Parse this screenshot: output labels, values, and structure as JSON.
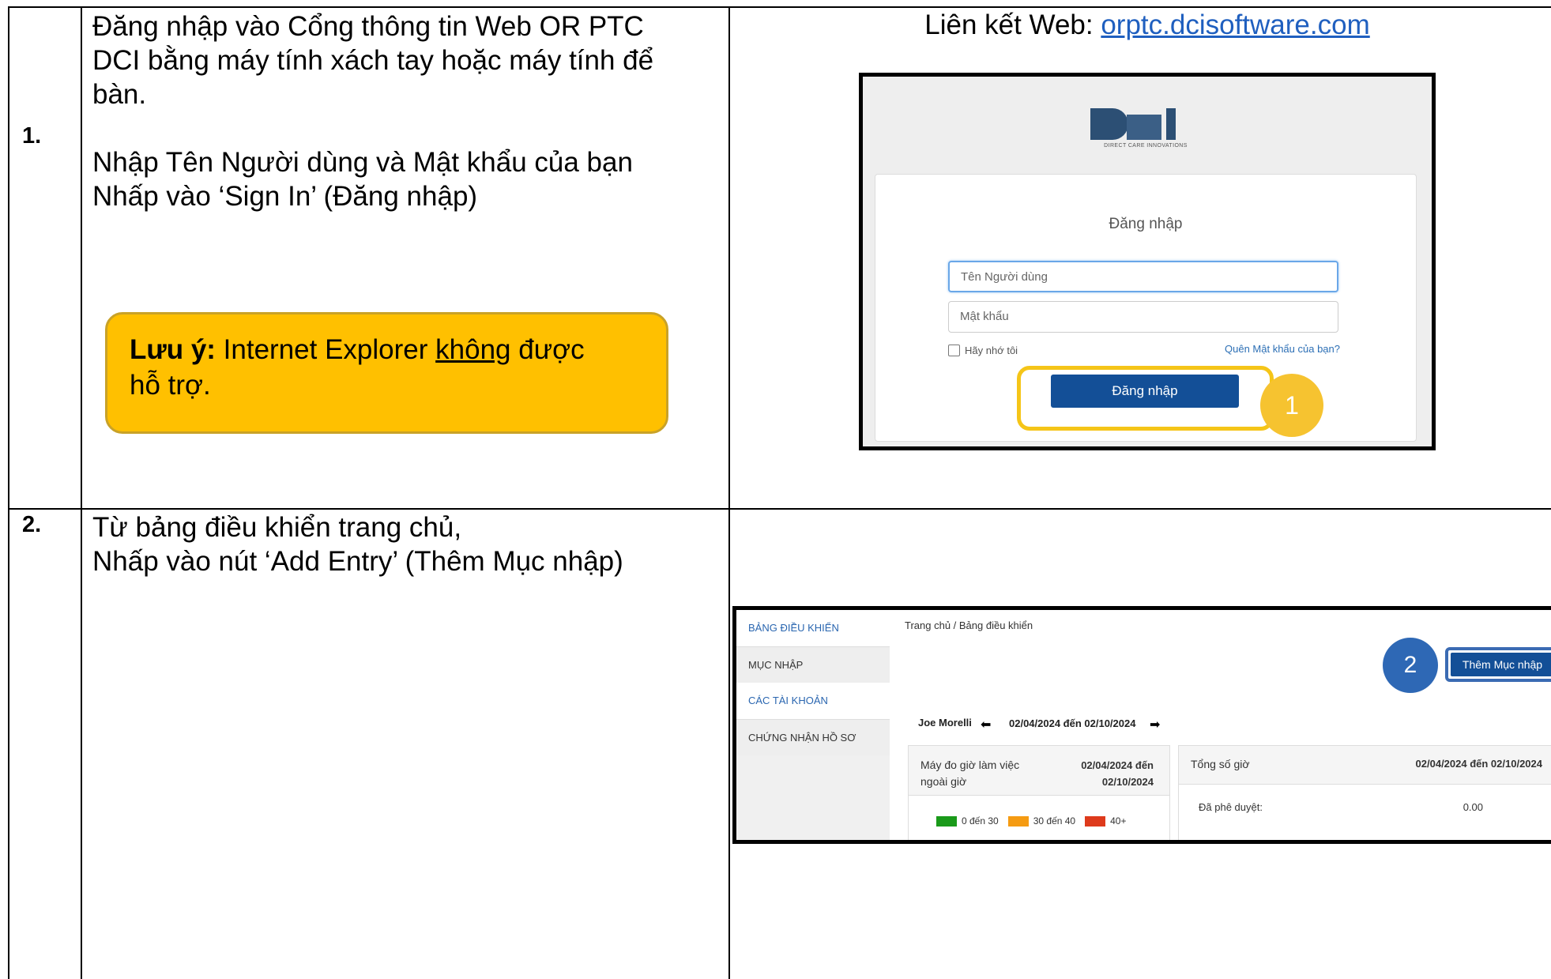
{
  "step1": {
    "number": "1.",
    "instr_lines": [
      "Đăng nhập vào Cổng thông tin Web OR PTC",
      "DCI bằng máy tính xách tay hoặc máy tính để",
      "bàn."
    ],
    "instr2_lines": [
      "Nhập Tên Người dùng và Mật khẩu của bạn",
      "Nhấp vào ‘Sign In’ (Đăng nhập)"
    ],
    "note": {
      "bold": "Lưu ý:",
      "text1": " Internet Explorer ",
      "underlined": "không",
      "text2": " được",
      "line2": "hỗ trợ."
    },
    "weblink_label": "Liên kết Web: ",
    "weblink_url": "orptc.dcisoftware.com",
    "login": {
      "logo_letters": "DCI",
      "logo_tagline": "DIRECT CARE INNOVATIONS",
      "title": "Đăng nhập",
      "username_placeholder": "Tên Người dùng",
      "password_placeholder": "Mật khẩu",
      "remember_me": "Hãy nhớ tôi",
      "forgot_password": "Quên Mật khẩu của bạn?",
      "signin_button": "Đăng nhập",
      "callout": "1"
    }
  },
  "step2": {
    "number": "2.",
    "instr_lines": [
      "Từ bảng điều khiển trang chủ,",
      "Nhấp vào nút ‘Add Entry’ (Thêm Mục nhập)"
    ],
    "dashboard": {
      "sidebar": [
        "BẢNG ĐIỀU KHIỂN",
        "MỤC NHẬP",
        "CÁC TÀI KHOẢN",
        "CHỨNG NHẬN HỒ SƠ"
      ],
      "breadcrumb": "Trang chủ / Bảng điều khiển",
      "callout": "2",
      "add_button": "Thêm Mục nhập",
      "user": "Joe Morelli",
      "date_range": "02/04/2024 đến 02/10/2024",
      "overtime_title": "Máy đo giờ làm việc ngoài giờ",
      "overtime_range": "02/04/2024 đến 02/10/2024",
      "legend": [
        {
          "label": "0 đến 30",
          "color": "#1a9a1a"
        },
        {
          "label": "30 đến 40",
          "color": "#f59b12"
        },
        {
          "label": "40+",
          "color": "#de3a1c"
        }
      ],
      "total_title": "Tổng số giờ",
      "total_range": "02/04/2024 đến 02/10/2024",
      "approved_label": "Đã phê duyệt:",
      "approved_value": "0.00"
    }
  }
}
